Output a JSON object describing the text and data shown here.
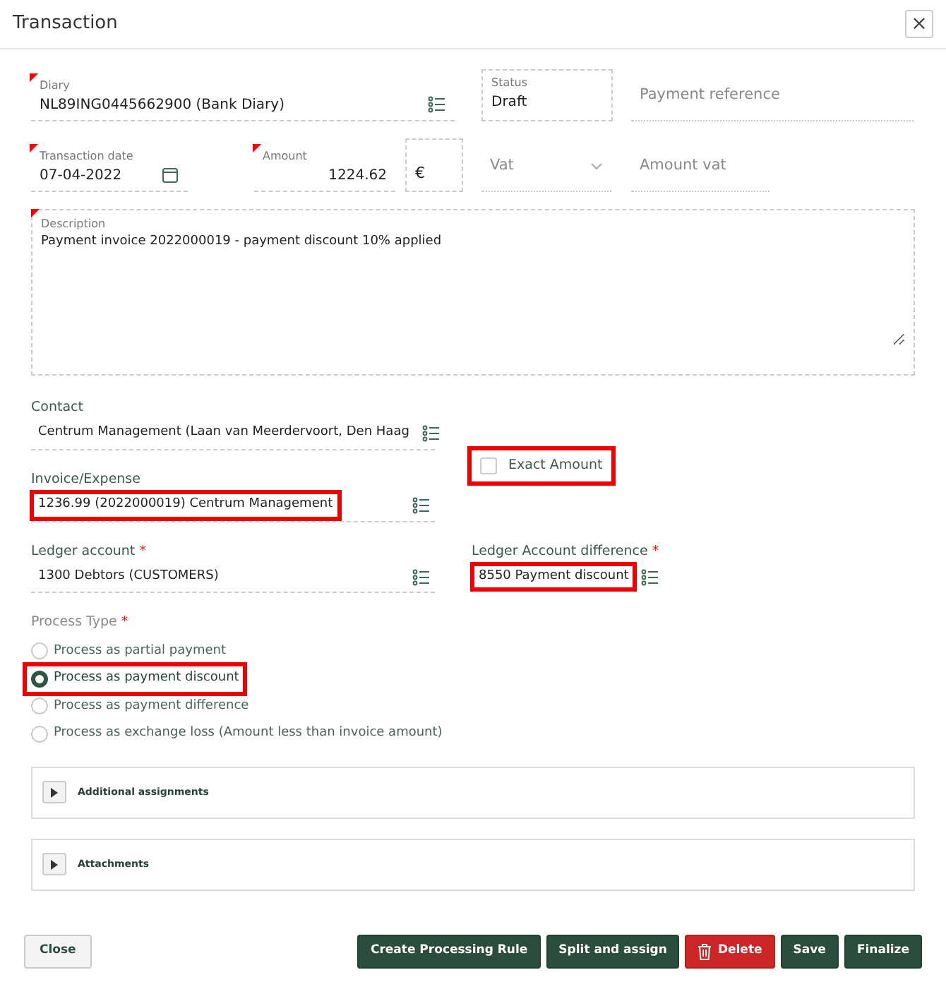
{
  "window": {
    "title": "Transaction",
    "close": "×"
  },
  "diary": {
    "label": "Diary",
    "value": "NL89ING0445662900 (Bank Diary)",
    "required": true
  },
  "status": {
    "label": "Status",
    "value": "Draft"
  },
  "payment_reference": {
    "placeholder": "Payment reference"
  },
  "transaction_date": {
    "label": "Transaction date",
    "value": "07-04-2022",
    "required": true
  },
  "amount": {
    "label": "Amount",
    "value": "1224.62",
    "required": true
  },
  "currency": {
    "value": "€"
  },
  "vat": {
    "placeholder": "Vat"
  },
  "amount_vat": {
    "placeholder": "Amount vat"
  },
  "description": {
    "label": "Description",
    "value": "Payment invoice 2022000019 - payment discount 10% applied",
    "required": true
  },
  "contact": {
    "label": "Contact",
    "value": "Centrum Management (Laan van Meerdervoort, Den Haag",
    "highlighted": false
  },
  "invoice": {
    "label": "Invoice/Expense",
    "value": "1236.99 (2022000019) Centrum Management",
    "highlighted": true
  },
  "exact_amount": {
    "label": "Exact Amount",
    "checked": false,
    "highlighted": true
  },
  "ledger_account": {
    "label": "Ledger account",
    "star": "*",
    "value": "1300 Debtors (CUSTOMERS)",
    "highlighted": false
  },
  "ledger_difference": {
    "label": "Ledger Account difference",
    "star": "*",
    "value": "8550 Payment discount",
    "highlighted": true
  },
  "process_type": {
    "label": "Process Type",
    "star": "*",
    "options": [
      {
        "label": "Process as partial payment",
        "selected": false,
        "highlighted": false
      },
      {
        "label": "Process as payment discount",
        "selected": true,
        "highlighted": true
      },
      {
        "label": "Process as payment difference",
        "selected": false,
        "highlighted": false
      },
      {
        "label": "Process as exchange loss (Amount less than invoice amount)",
        "selected": false,
        "highlighted": false
      }
    ]
  },
  "panels": [
    {
      "title": "Additional assignments",
      "expanded": false
    },
    {
      "title": "Attachments",
      "expanded": false
    }
  ],
  "buttons": [
    {
      "label": "Close",
      "kind": "light"
    },
    {
      "label": "Create Processing Rule",
      "kind": "primary"
    },
    {
      "label": "Split and assign",
      "kind": "primary"
    },
    {
      "label": "Delete",
      "kind": "danger"
    },
    {
      "label": "Save",
      "kind": "primary"
    },
    {
      "label": "Finalize",
      "kind": "primary"
    }
  ]
}
